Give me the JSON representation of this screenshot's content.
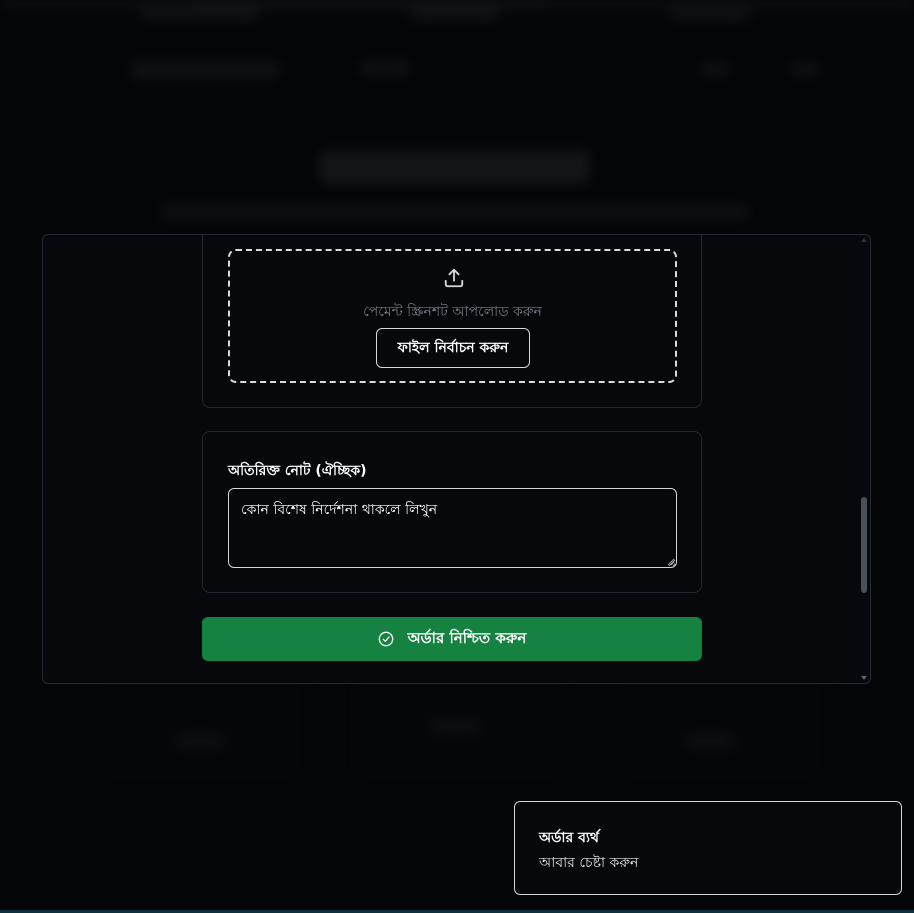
{
  "upload": {
    "prompt": "পেমেন্ট স্ক্রিনশট আপলোড করুন",
    "button_label": "ফাইল নির্বাচন করুন"
  },
  "note": {
    "label": "অতিরিক্ত নোট (ঐচ্ছিক)",
    "placeholder": "কোন বিশেষ নির্দেশনা থাকলে লিখুন"
  },
  "confirm": {
    "label": "অর্ডার নিশ্চিত করুন"
  },
  "toast": {
    "title": "অর্ডার ব্যর্থ",
    "description": "আবার চেষ্টা করুন"
  },
  "icons": {
    "upload": "upload-icon",
    "confirm": "check-circle-icon"
  },
  "colors": {
    "confirm_button": "#168241",
    "background": "#07080b"
  }
}
